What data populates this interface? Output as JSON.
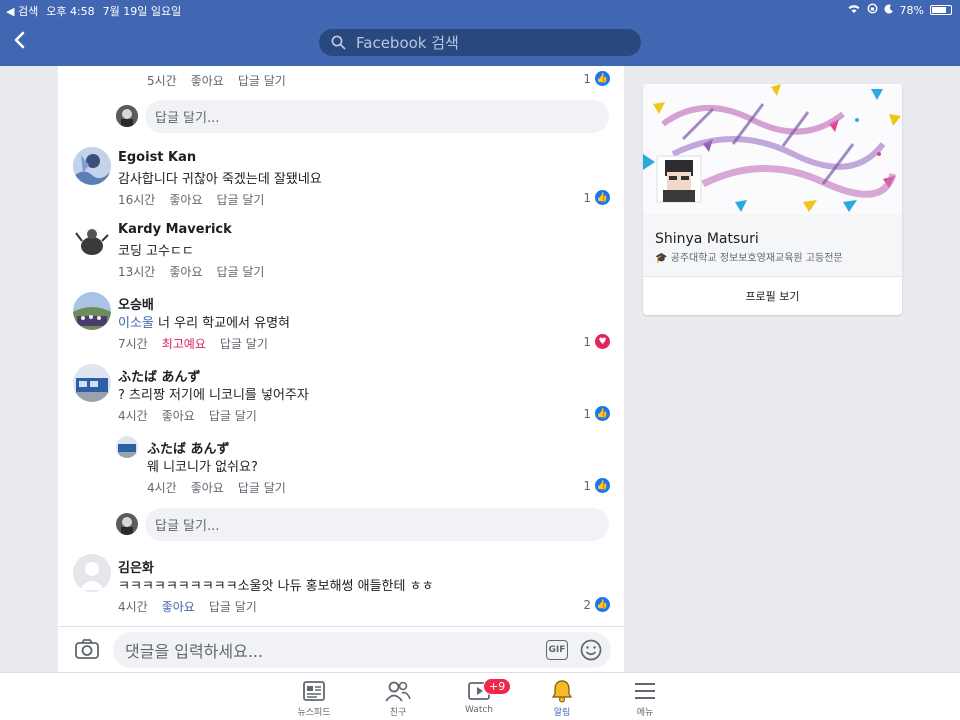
{
  "status": {
    "back_app": "◀ 검색",
    "time": "오후 4:58",
    "date": "7월 19일 일요일",
    "battery": "78%",
    "battery_level": 0.78
  },
  "search": {
    "placeholder": "Facebook 검색"
  },
  "top_row": {
    "time": "5시간",
    "like": "좋아요",
    "reply": "답글 달기",
    "count": "1"
  },
  "reply_placeholder": "답글 달기...",
  "comments": [
    {
      "name": "Egoist Kan",
      "text": "감사합니다 귀찮아 죽겠는데 잘됐네요",
      "time": "16시간",
      "like": "좋아요",
      "reply": "답글 달기",
      "count": "1"
    },
    {
      "name": "Kardy Maverick",
      "text": "코딩 고수ㄷㄷ",
      "time": "13시간",
      "like": "좋아요",
      "reply": "답글 달기"
    },
    {
      "name": "오승배",
      "mention": "이소울",
      "text": " 너 우리 학교에서 유명혀",
      "time": "7시간",
      "like": "최고예요",
      "reply": "답글 달기",
      "count": "1"
    },
    {
      "name": "ふたば あんず",
      "text": "?  츠리짱 저기에 니코니를 넣어주자",
      "time": "4시간",
      "like": "좋아요",
      "reply": "답글 달기",
      "count": "1"
    },
    {
      "name": "ふたば あんず",
      "text": "웨 니코니가 없쉬요?",
      "time": "4시간",
      "like": "좋아요",
      "reply": "답글 달기",
      "count": "1"
    },
    {
      "name": "김은화",
      "text": "ㅋㅋㅋㅋㅋㅋㅋㅋㅋㅋ소울앗 나듀 홍보해썽 애들한테 ㅎㅎ",
      "time": "4시간",
      "like": "좋아요",
      "reply": "답글 달기",
      "count": "2"
    }
  ],
  "comment_input": {
    "placeholder": "댓글을 입력하세요...",
    "gif": "GIF"
  },
  "profile": {
    "name": "Shinya Matsuri",
    "sub": "공주대학교 정보보호영재교육원 고등전문",
    "button": "프로필 보기"
  },
  "tabs": [
    {
      "label": "뉴스피드"
    },
    {
      "label": "친구"
    },
    {
      "label": "Watch",
      "badge": "+9"
    },
    {
      "label": "알림"
    },
    {
      "label": "메뉴"
    }
  ],
  "colors": {
    "brand": "#4267b2",
    "love": "#e0245e",
    "like": "#1877f2"
  }
}
